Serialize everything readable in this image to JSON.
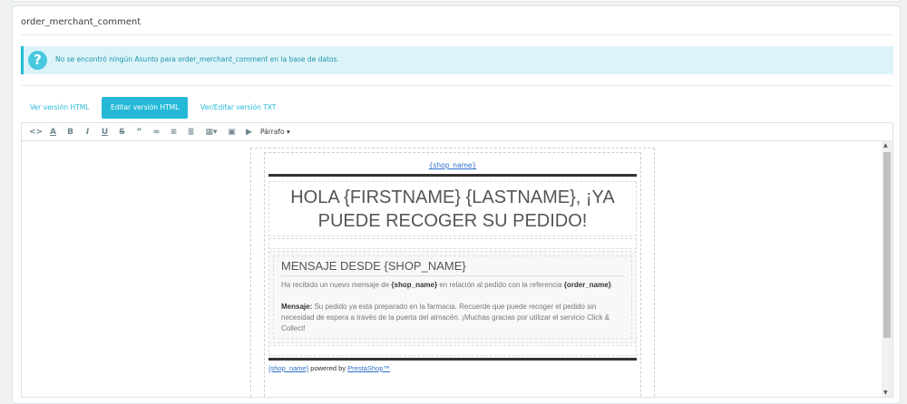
{
  "panel": {
    "title": "order_merchant_comment"
  },
  "alert": {
    "icon": "question-circle-icon",
    "text": "No se encontró ningún Asunto para order_merchant_comment en la base de datos."
  },
  "tabs": [
    {
      "label": "Ver versión HTML"
    },
    {
      "label": "Editar versión HTML"
    },
    {
      "label": "Ver/Editar versión TXT"
    }
  ],
  "toolbar": {
    "icons": [
      "<>",
      "A",
      "B",
      "I",
      "U",
      "S",
      "”",
      "∞",
      "≡",
      "≣",
      "▦▾",
      "▣",
      "▶"
    ],
    "paragraph": "Párrafo ▾"
  },
  "email": {
    "logo_alt": "{shop_name}",
    "heading": "HOLA {FIRSTNAME} {LASTNAME}, ¡YA PUEDE RECOGER SU PEDIDO!",
    "box_title": "MENSAJE DESDE {SHOP_NAME}",
    "p1_a": "Ha recibido un nuevo mensaje de ",
    "p1_b": "{shop_name}",
    "p1_c": " en relación al pedido con la referencia ",
    "p1_d": "{order_name}",
    "p1_e": ".",
    "p2_label": "Mensaje:",
    "p2_text": " Su pedido ya está preparado en la farmacia. Recuerde que puede recoger el pedido sin necesidad de espera a través de la puerta del almacén. ¡Muchas gracias por utilizar el servicio Click & Collect!",
    "footer_shop": "{shop_name}",
    "footer_mid": " powered by ",
    "footer_link": "PrestaShop™"
  }
}
